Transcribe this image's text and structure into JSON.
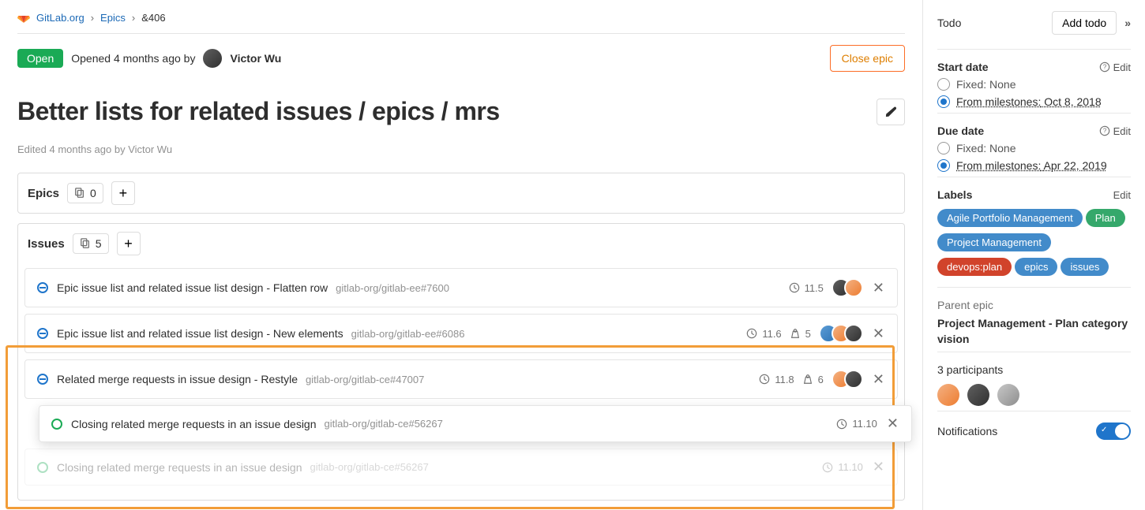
{
  "breadcrumb": {
    "org": "GitLab.org",
    "sep": "›",
    "section": "Epics",
    "epic_ref": "&406"
  },
  "header": {
    "status": "Open",
    "opened_text": "Opened 4 months ago by",
    "author": "Victor Wu",
    "close_button": "Close epic"
  },
  "title": "Better lists for related issues / epics / mrs",
  "edited": "Edited 4 months ago by Victor Wu",
  "panels": {
    "epics": {
      "title": "Epics",
      "count": "0"
    },
    "issues": {
      "title": "Issues",
      "count": "5"
    }
  },
  "issues": {
    "r0": {
      "title": "Epic issue list and related issue list design - Flatten row",
      "ref": "gitlab-org/gitlab-ee#7600",
      "milestone": "11.5"
    },
    "r1": {
      "title": "Epic issue list and related issue list design - New elements",
      "ref": "gitlab-org/gitlab-ee#6086",
      "milestone": "11.6",
      "weight": "5"
    },
    "r2": {
      "title": "Related merge requests in issue design - Restyle",
      "ref": "gitlab-org/gitlab-ce#47007",
      "milestone": "11.8",
      "weight": "6"
    },
    "r3": {
      "title": "Closing related merge requests in an issue design",
      "ref": "gitlab-org/gitlab-ce#56267",
      "milestone": "11.10"
    },
    "r4": {
      "title": "Closing related merge requests in an issue design",
      "ref": "gitlab-org/gitlab-ce#56267",
      "milestone": "11.10"
    }
  },
  "sidebar": {
    "todo": {
      "title": "Todo",
      "button": "Add todo"
    },
    "start_date": {
      "title": "Start date",
      "edit": "Edit",
      "fixed_label": "Fixed:",
      "fixed_value": "None",
      "milestones_label": "From milestones:",
      "milestones_value": "Oct 8, 2018"
    },
    "due_date": {
      "title": "Due date",
      "edit": "Edit",
      "fixed_label": "Fixed:",
      "fixed_value": "None",
      "milestones_label": "From milestones:",
      "milestones_value": "Apr 22, 2019"
    },
    "labels": {
      "title": "Labels",
      "edit": "Edit",
      "items": [
        {
          "text": "Agile Portfolio Management",
          "color": "#428bca"
        },
        {
          "text": "Plan",
          "color": "#35a86b"
        },
        {
          "text": "Project Management",
          "color": "#428bca"
        },
        {
          "text": "devops:plan",
          "color": "#d1432b"
        },
        {
          "text": "epics",
          "color": "#428bca"
        },
        {
          "text": "issues",
          "color": "#428bca"
        }
      ]
    },
    "parent_epic": {
      "title": "Parent epic",
      "value": "Project Management - Plan category vision"
    },
    "participants": {
      "title": "3 participants"
    },
    "notifications": {
      "title": "Notifications"
    }
  }
}
